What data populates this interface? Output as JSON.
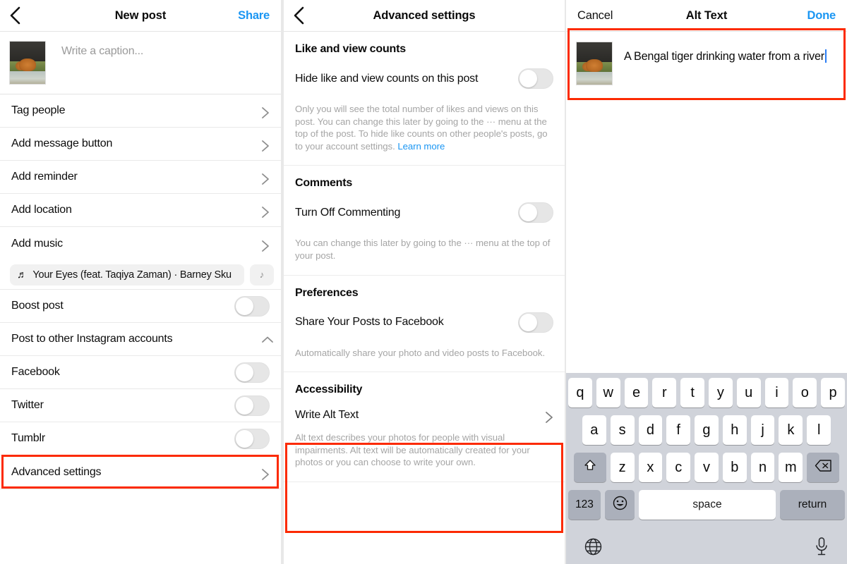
{
  "colors": {
    "accent_blue": "#1a96f3",
    "annotation_red": "#fc2a00",
    "keyboard_bg": "#d0d3da",
    "toggle_off": "#e6e6e6"
  },
  "panel_left": {
    "nav": {
      "back_icon": "chevron-left-icon",
      "title": "New post",
      "action": "Share"
    },
    "caption": {
      "placeholder": "Write a caption...",
      "thumbnail_alt": "tiger-photo-thumbnail"
    },
    "rows": [
      {
        "label": "Tag people",
        "type": "chevron"
      },
      {
        "label": "Add message button",
        "type": "chevron"
      },
      {
        "label": "Add reminder",
        "type": "chevron"
      },
      {
        "label": "Add location",
        "type": "chevron"
      },
      {
        "label": "Add music",
        "type": "chevron"
      }
    ],
    "music": {
      "note_icon": "music-note-icon",
      "track": "Your Eyes (feat. Taqiya Zaman) · Barney Sku",
      "second_chip_icon": "music-note-icon"
    },
    "toggle_rows": [
      {
        "label": "Boost post",
        "state": "off"
      }
    ],
    "accounts_header": {
      "label": "Post to other Instagram accounts",
      "chevron": "chevron-up-icon"
    },
    "accounts": [
      {
        "label": "Facebook",
        "state": "off"
      },
      {
        "label": "Twitter",
        "state": "off"
      },
      {
        "label": "Tumblr",
        "state": "off"
      }
    ],
    "advanced": {
      "label": "Advanced settings",
      "highlighted": true
    }
  },
  "panel_mid": {
    "nav": {
      "back_icon": "chevron-left-icon",
      "title": "Advanced settings"
    },
    "sections": [
      {
        "title": "Like and view counts",
        "setting": {
          "label": "Hide like and view counts on this post",
          "state": "off"
        },
        "helper": "Only you will see the total number of likes and views on this post. You can change this later by going to the ··· menu at the top of the post. To hide like counts on other people's posts, go to your account settings. ",
        "helper_link": "Learn more"
      },
      {
        "title": "Comments",
        "setting": {
          "label": "Turn Off Commenting",
          "state": "off"
        },
        "helper": "You can change this later by going to the ··· menu at the top of your post.",
        "helper_link": ""
      },
      {
        "title": "Preferences",
        "setting": {
          "label": "Share Your Posts to Facebook",
          "state": "off"
        },
        "helper": "Automatically share your photo and video posts to Facebook.",
        "helper_link": ""
      }
    ],
    "accessibility": {
      "title": "Accessibility",
      "row_label": "Write Alt Text",
      "helper": "Alt text describes your photos for people with visual impairments. Alt text will be automatically created for your photos or you can choose to write your own.",
      "highlighted": true
    }
  },
  "panel_right": {
    "nav": {
      "cancel": "Cancel",
      "title": "Alt Text",
      "done": "Done"
    },
    "alt_editor": {
      "thumbnail_alt": "tiger-photo-thumbnail",
      "value": "A Bengal tiger drinking water from a river",
      "highlighted": true
    },
    "keyboard": {
      "row1": [
        "q",
        "w",
        "e",
        "r",
        "t",
        "y",
        "u",
        "i",
        "o",
        "p"
      ],
      "row2": [
        "a",
        "s",
        "d",
        "f",
        "g",
        "h",
        "j",
        "k",
        "l"
      ],
      "row3": [
        "z",
        "x",
        "c",
        "v",
        "b",
        "n",
        "m"
      ],
      "shift_icon": "shift-arrow-icon",
      "backspace_icon": "backspace-icon",
      "numbers_key": "123",
      "emoji_icon": "emoji-smiley-icon",
      "space_key": "space",
      "return_key": "return",
      "globe_icon": "globe-icon",
      "mic_icon": "microphone-icon"
    }
  }
}
